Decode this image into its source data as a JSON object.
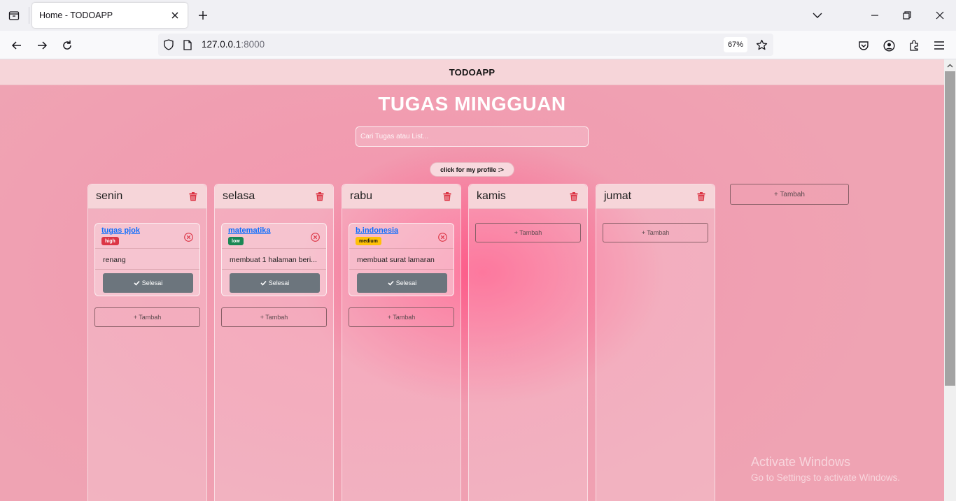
{
  "browser": {
    "tab_title": "Home - TODOAPP",
    "url_host": "127.0.0.1",
    "url_port": ":8000",
    "zoom": "67%"
  },
  "app": {
    "brand": "TODOAPP",
    "page_title": "TUGAS MINGGUAN",
    "search_placeholder": "Cari Tugas atau List...",
    "profile_button": "click for my profile :>",
    "add_label": "+ Tambah",
    "add_list_label": "+ Tambah",
    "done_label": "Selesai"
  },
  "lists": [
    {
      "name": "senin",
      "task": {
        "title": "tugas pjok",
        "priority": "high",
        "description": "renang"
      }
    },
    {
      "name": "selasa",
      "task": {
        "title": "matematika",
        "priority": "low",
        "description": "membuat 1 halaman beri..."
      }
    },
    {
      "name": "rabu",
      "task": {
        "title": "b.indonesia",
        "priority": "medium",
        "description": "membuat surat lamaran"
      }
    },
    {
      "name": "kamis"
    },
    {
      "name": "jumat"
    }
  ],
  "priority_colors": {
    "high": "#dc3545",
    "low": "#198754",
    "medium": "#ffc107"
  },
  "watermark": {
    "title": "Activate Windows",
    "subtitle": "Go to Settings to activate Windows."
  }
}
